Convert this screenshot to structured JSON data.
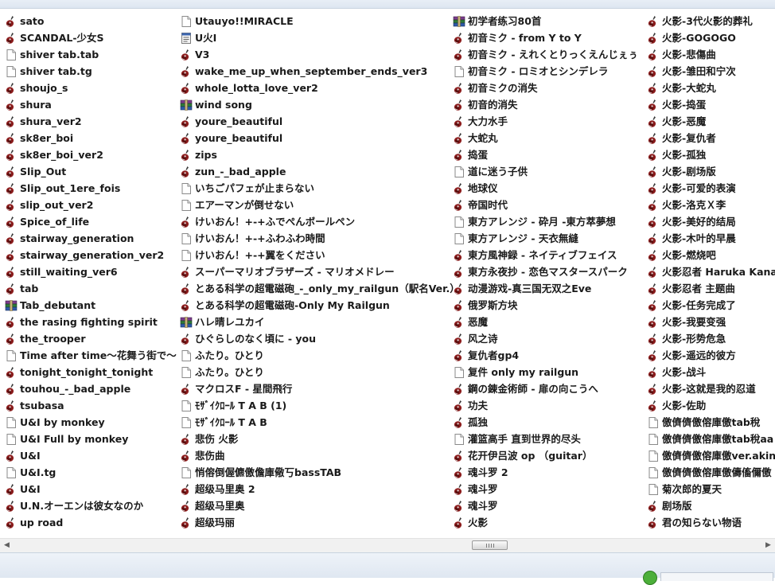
{
  "columns": [
    [
      {
        "name": "sato",
        "icon": "guitar-file-icon"
      },
      {
        "name": "SCANDAL-少女S",
        "icon": "guitar-file-icon"
      },
      {
        "name": "shiver tab.tab",
        "icon": "blank-file-icon"
      },
      {
        "name": "shiver tab.tg",
        "icon": "blank-file-icon"
      },
      {
        "name": "shoujo_s",
        "icon": "guitar-file-icon"
      },
      {
        "name": "shura",
        "icon": "guitar-file-icon"
      },
      {
        "name": "shura_ver2",
        "icon": "guitar-file-icon"
      },
      {
        "name": "sk8er_boi",
        "icon": "guitar-file-icon"
      },
      {
        "name": "sk8er_boi_ver2",
        "icon": "guitar-file-icon"
      },
      {
        "name": "Slip_Out",
        "icon": "guitar-file-icon"
      },
      {
        "name": "Slip_out_1ere_fois",
        "icon": "guitar-file-icon"
      },
      {
        "name": "slip_out_ver2",
        "icon": "guitar-file-icon"
      },
      {
        "name": "Spice_of_life",
        "icon": "guitar-file-icon"
      },
      {
        "name": "stairway_generation",
        "icon": "guitar-file-icon"
      },
      {
        "name": "stairway_generation_ver2",
        "icon": "guitar-file-icon"
      },
      {
        "name": "still_waiting_ver6",
        "icon": "guitar-file-icon"
      },
      {
        "name": "tab",
        "icon": "guitar-file-icon"
      },
      {
        "name": "Tab_debutant",
        "icon": "archive-icon"
      },
      {
        "name": "the rasing fighting spirit",
        "icon": "guitar-file-icon"
      },
      {
        "name": "the_trooper",
        "icon": "guitar-file-icon"
      },
      {
        "name": "Time after time～花舞う街で～",
        "icon": "blank-file-icon"
      },
      {
        "name": "tonight_tonight_tonight",
        "icon": "guitar-file-icon"
      },
      {
        "name": "touhou_-_bad_apple",
        "icon": "guitar-file-icon"
      },
      {
        "name": "tsubasa",
        "icon": "guitar-file-icon"
      },
      {
        "name": "U&I by monkey",
        "icon": "blank-file-icon"
      },
      {
        "name": "U&I Full by monkey",
        "icon": "blank-file-icon"
      },
      {
        "name": "U&I",
        "icon": "guitar-file-icon"
      },
      {
        "name": "U&I.tg",
        "icon": "blank-file-icon"
      },
      {
        "name": "U&I",
        "icon": "guitar-file-icon"
      },
      {
        "name": "U.N.オーエンは彼女なのか",
        "icon": "guitar-file-icon"
      },
      {
        "name": "up road",
        "icon": "guitar-file-icon"
      }
    ],
    [
      {
        "name": "Utauyo!!MIRACLE",
        "icon": "blank-file-icon"
      },
      {
        "name": "U火I",
        "icon": "settings-file-icon"
      },
      {
        "name": "V3",
        "icon": "guitar-file-icon"
      },
      {
        "name": "wake_me_up_when_september_ends_ver3",
        "icon": "guitar-file-icon"
      },
      {
        "name": "whole_lotta_love_ver2",
        "icon": "guitar-file-icon"
      },
      {
        "name": "wind song",
        "icon": "archive-icon"
      },
      {
        "name": "youre_beautiful",
        "icon": "guitar-file-icon"
      },
      {
        "name": "youre_beautiful",
        "icon": "guitar-file-icon"
      },
      {
        "name": "zips",
        "icon": "guitar-file-icon"
      },
      {
        "name": "zun_-_bad_apple",
        "icon": "guitar-file-icon"
      },
      {
        "name": "いちごパフェが止まらない",
        "icon": "blank-file-icon"
      },
      {
        "name": "エアーマンが倒せない",
        "icon": "blank-file-icon"
      },
      {
        "name": "けいおん！+-+ふでぺんボールペン",
        "icon": "guitar-file-icon"
      },
      {
        "name": "けいおん！+-+ふわふわ時間",
        "icon": "blank-file-icon"
      },
      {
        "name": "けいおん！+-+翼をください",
        "icon": "blank-file-icon"
      },
      {
        "name": "スーパーマリオブラザーズ - マリオメドレー",
        "icon": "guitar-file-icon"
      },
      {
        "name": "とある科学の超電磁砲_-_only_my_railgun（駅名Ver.）",
        "icon": "guitar-file-icon"
      },
      {
        "name": "とある科学の超電磁砲-Only My Railgun",
        "icon": "guitar-file-icon"
      },
      {
        "name": "ハレ晴レユカイ",
        "icon": "archive-icon"
      },
      {
        "name": "ひぐらしのなく頃に - you",
        "icon": "guitar-file-icon"
      },
      {
        "name": "ふたり。ひとり",
        "icon": "blank-file-icon"
      },
      {
        "name": "ふたり。ひとり",
        "icon": "blank-file-icon"
      },
      {
        "name": "マクロスF - 星間飛行",
        "icon": "guitar-file-icon"
      },
      {
        "name": "ﾓｻﾞｲｸﾛｰﾙ T A B (1)",
        "icon": "blank-file-icon"
      },
      {
        "name": "ﾓｻﾞｲｸﾛｰﾙ T A B",
        "icon": "blank-file-icon"
      },
      {
        "name": "悲伤 火影",
        "icon": "guitar-file-icon"
      },
      {
        "name": "悲伤曲",
        "icon": "guitar-file-icon"
      },
      {
        "name": "悄傛倒偓儦儌儋庫儆丂bassTAB",
        "icon": "blank-file-icon"
      },
      {
        "name": "超级马里奥 2",
        "icon": "guitar-file-icon"
      },
      {
        "name": "超级马里奥",
        "icon": "guitar-file-icon"
      },
      {
        "name": "超级玛丽",
        "icon": "guitar-file-icon"
      }
    ],
    [
      {
        "name": "初学者练习80首",
        "icon": "archive-icon"
      },
      {
        "name": "初音ミク - from Y to Y",
        "icon": "guitar-file-icon"
      },
      {
        "name": "初音ミク - えれくとりっくえんじぇぅ",
        "icon": "guitar-file-icon"
      },
      {
        "name": "初音ミク - ロミオとシンデレラ",
        "icon": "blank-file-icon"
      },
      {
        "name": "初音ミクの消失",
        "icon": "guitar-file-icon"
      },
      {
        "name": "初音的消失",
        "icon": "guitar-file-icon"
      },
      {
        "name": "大力水手",
        "icon": "guitar-file-icon"
      },
      {
        "name": "大蛇丸",
        "icon": "guitar-file-icon"
      },
      {
        "name": "捣蛋",
        "icon": "guitar-file-icon"
      },
      {
        "name": "道に迷う子供",
        "icon": "blank-file-icon"
      },
      {
        "name": "地球仪",
        "icon": "guitar-file-icon"
      },
      {
        "name": "帝国时代",
        "icon": "guitar-file-icon"
      },
      {
        "name": "東方アレンジ - 砕月 -東方萃夢想",
        "icon": "blank-file-icon"
      },
      {
        "name": "東方アレンジ - 天衣無縫",
        "icon": "blank-file-icon"
      },
      {
        "name": "東方風神録 - ネイティブフェイス",
        "icon": "guitar-file-icon"
      },
      {
        "name": "東方永夜抄 - 恋色マスタースパーク",
        "icon": "guitar-file-icon"
      },
      {
        "name": "动漫游戏-真三国无双之Eve",
        "icon": "guitar-file-icon"
      },
      {
        "name": "俄罗斯方块",
        "icon": "guitar-file-icon"
      },
      {
        "name": "恶魔",
        "icon": "guitar-file-icon"
      },
      {
        "name": "风之诗",
        "icon": "guitar-file-icon"
      },
      {
        "name": "复仇者gp4",
        "icon": "guitar-file-icon"
      },
      {
        "name": "复件 only my railgun",
        "icon": "blank-file-icon"
      },
      {
        "name": "鋼の錬金術師 - 扉の向こうへ",
        "icon": "guitar-file-icon"
      },
      {
        "name": "功夫",
        "icon": "guitar-file-icon"
      },
      {
        "name": "孤独",
        "icon": "guitar-file-icon"
      },
      {
        "name": "灌篮高手 直到世界的尽头",
        "icon": "blank-file-icon"
      },
      {
        "name": "花开伊吕波 op （guitar）",
        "icon": "guitar-file-icon"
      },
      {
        "name": "魂斗罗 2",
        "icon": "guitar-file-icon"
      },
      {
        "name": "魂斗罗",
        "icon": "guitar-file-icon"
      },
      {
        "name": "魂斗罗",
        "icon": "guitar-file-icon"
      },
      {
        "name": "火影",
        "icon": "guitar-file-icon"
      }
    ],
    [
      {
        "name": "火影-3代火影的葬礼",
        "icon": "guitar-file-icon"
      },
      {
        "name": "火影-GOGOGO",
        "icon": "guitar-file-icon"
      },
      {
        "name": "火影-悲傷曲",
        "icon": "guitar-file-icon"
      },
      {
        "name": "火影-雏田和宁次",
        "icon": "guitar-file-icon"
      },
      {
        "name": "火影-大蛇丸",
        "icon": "guitar-file-icon"
      },
      {
        "name": "火影-捣蛋",
        "icon": "guitar-file-icon"
      },
      {
        "name": "火影-恶魔",
        "icon": "guitar-file-icon"
      },
      {
        "name": "火影-复仇者",
        "icon": "guitar-file-icon"
      },
      {
        "name": "火影-孤独",
        "icon": "guitar-file-icon"
      },
      {
        "name": "火影-剧场版",
        "icon": "guitar-file-icon"
      },
      {
        "name": "火影-可爱的表演",
        "icon": "guitar-file-icon"
      },
      {
        "name": "火影-洛克Ｘ李",
        "icon": "guitar-file-icon"
      },
      {
        "name": "火影-美好的结局",
        "icon": "guitar-file-icon"
      },
      {
        "name": "火影-木叶的早晨",
        "icon": "guitar-file-icon"
      },
      {
        "name": "火影-燃烧吧",
        "icon": "guitar-file-icon"
      },
      {
        "name": "火影忍者 Haruka Kanata",
        "icon": "guitar-file-icon"
      },
      {
        "name": "火影忍者 主题曲",
        "icon": "guitar-file-icon"
      },
      {
        "name": "火影-任务完成了",
        "icon": "guitar-file-icon"
      },
      {
        "name": "火影-我要变强",
        "icon": "guitar-file-icon"
      },
      {
        "name": "火影-形势危急",
        "icon": "guitar-file-icon"
      },
      {
        "name": "火影-遥远的彼方",
        "icon": "guitar-file-icon"
      },
      {
        "name": "火影-战斗",
        "icon": "guitar-file-icon"
      },
      {
        "name": "火影-这就是我的忍道",
        "icon": "guitar-file-icon"
      },
      {
        "name": "火影-佐助",
        "icon": "guitar-file-icon"
      },
      {
        "name": "儌儕儕儌傛庫儌tab稅",
        "icon": "blank-file-icon"
      },
      {
        "name": "儌儕儕儌傛庫儌tab稅aa",
        "icon": "blank-file-icon"
      },
      {
        "name": "儌儕儕儌傛庫儌ver.akino",
        "icon": "blank-file-icon"
      },
      {
        "name": "儌儕儕儌傛庫儌儔傗儞儌",
        "icon": "blank-file-icon"
      },
      {
        "name": "菊次郎的夏天",
        "icon": "blank-file-icon"
      },
      {
        "name": "剧场版",
        "icon": "guitar-file-icon"
      },
      {
        "name": "君の知らない物语",
        "icon": "guitar-file-icon"
      }
    ]
  ],
  "scrollbar": {
    "left_arrow": "◀",
    "right_arrow": "▶"
  }
}
